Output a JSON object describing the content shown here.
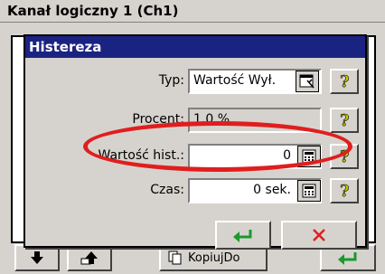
{
  "window": {
    "title": "Kanał logiczny 1 (Ch1)"
  },
  "dialog": {
    "title": "Histereza",
    "rows": {
      "typ": {
        "label": "Typ:",
        "value": "Wartość Wył."
      },
      "procent": {
        "label": "Procent:",
        "value": "1.0 %"
      },
      "wartosc_hist": {
        "label": "Wartość hist.:",
        "value": "0"
      },
      "czas": {
        "label": "Czas:",
        "value": "0 sek."
      }
    }
  },
  "bottom_bar": {
    "copy_label": "KopiujDo"
  },
  "colors": {
    "title_bar": "#1b2382",
    "highlight": "#e01e1e",
    "ok_arrow": "#1a9a2a",
    "cancel_x": "#e01e1e"
  },
  "icons": {
    "help": "question-mark-icon",
    "select": "properties-icon",
    "keypad": "calculator-icon",
    "ok": "enter-arrow-icon",
    "cancel": "x-icon",
    "down": "arrow-down-icon",
    "up": "arrow-up-icon",
    "copy": "copy-icon"
  }
}
